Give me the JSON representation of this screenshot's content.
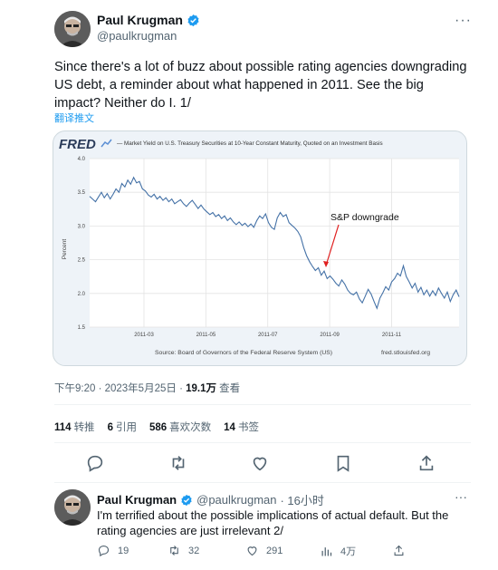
{
  "tweet": {
    "author_name": "Paul Krugman",
    "author_handle": "@paulkrugman",
    "text": "Since there's a lot of buzz about possible rating agencies downgrading US debt, a reminder about what happened in 2011. See the big impact? Neither do I. 1/",
    "translate_label": "翻译推文",
    "time": "下午9:20 · 2023年5月25日 · ",
    "views_count": "19.1万",
    "views_label": " 查看",
    "stats": [
      {
        "count": "114",
        "label": "转推"
      },
      {
        "count": "6",
        "label": "引用"
      },
      {
        "count": "586",
        "label": "喜欢次数"
      },
      {
        "count": "14",
        "label": "书签"
      }
    ],
    "more_icon": "more-icon"
  },
  "chart_data": {
    "type": "line",
    "brand": "FRED",
    "title": "— Market Yield on U.S. Treasury Securities at 10-Year Constant Maturity, Quoted on an Investment Basis",
    "ylabel": "Percent",
    "ylim": [
      1.5,
      4.0
    ],
    "yticks": [
      "4.0",
      "3.5",
      "3.0",
      "2.5",
      "2.0",
      "1.5"
    ],
    "xticks": [
      "2011-03",
      "2011-05",
      "2011-07",
      "2011-09",
      "2011-11"
    ],
    "annotation": "S&P downgrade",
    "source": "Source: Board of Governors of the Federal Reserve System (US)",
    "site": "fred.stlouisfed.org",
    "line_color": "#4572a7",
    "series": [
      {
        "values": [
          3.44,
          3.4,
          3.36,
          3.43,
          3.5,
          3.42,
          3.48,
          3.4,
          3.47,
          3.55,
          3.5,
          3.63,
          3.58,
          3.68,
          3.62,
          3.72,
          3.64,
          3.66,
          3.55,
          3.52,
          3.46,
          3.43,
          3.47,
          3.4,
          3.44,
          3.38,
          3.42,
          3.36,
          3.4,
          3.33,
          3.36,
          3.39,
          3.33,
          3.29,
          3.34,
          3.38,
          3.32,
          3.26,
          3.31,
          3.25,
          3.21,
          3.17,
          3.2,
          3.14,
          3.17,
          3.11,
          3.15,
          3.08,
          3.12,
          3.06,
          3.02,
          3.06,
          3.01,
          3.04,
          2.99,
          3.03,
          2.98,
          3.08,
          3.15,
          3.11,
          3.18,
          3.05,
          2.98,
          2.95,
          3.12,
          3.2,
          3.14,
          3.17,
          3.05,
          3.01,
          2.97,
          2.92,
          2.84,
          2.68,
          2.56,
          2.47,
          2.4,
          2.34,
          2.38,
          2.27,
          2.33,
          2.22,
          2.26,
          2.21,
          2.15,
          2.11,
          2.2,
          2.14,
          2.05,
          2.0,
          1.98,
          2.02,
          1.92,
          1.86,
          1.96,
          2.06,
          1.99,
          1.88,
          1.78,
          1.93,
          2.01,
          2.1,
          2.05,
          2.17,
          2.22,
          2.3,
          2.26,
          2.41,
          2.25,
          2.17,
          2.08,
          2.15,
          2.02,
          2.09,
          1.98,
          2.05,
          1.96,
          2.04,
          1.97,
          2.08,
          2.0,
          1.93,
          2.02,
          1.88,
          1.98,
          2.05,
          1.95
        ]
      }
    ]
  },
  "reply": {
    "author_name": "Paul Krugman",
    "author_handle": "@paulkrugman",
    "time": "· 16小时",
    "text": "I'm terrified about the possible implications of actual default. But the rating agencies are just irrelevant 2/",
    "counts": {
      "replies": "19",
      "retweets": "32",
      "likes": "291",
      "views": "4万"
    }
  }
}
